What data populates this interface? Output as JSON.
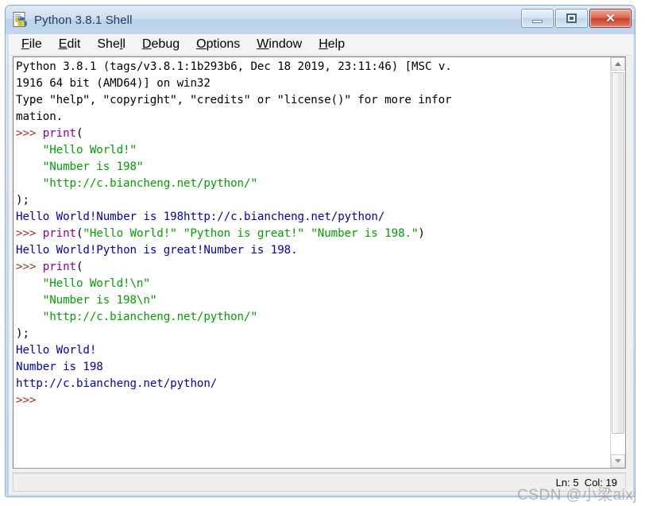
{
  "window": {
    "title": "Python 3.8.1 Shell",
    "icon": "python-idle-icon",
    "caption_buttons": [
      {
        "name": "minimize-button",
        "label": "–"
      },
      {
        "name": "maximize-button",
        "label": "□"
      },
      {
        "name": "close-button",
        "label": "✕"
      }
    ]
  },
  "menubar": {
    "items": [
      {
        "name": "menu-file",
        "pre": "",
        "mnemonic": "F",
        "post": "ile"
      },
      {
        "name": "menu-edit",
        "pre": "",
        "mnemonic": "E",
        "post": "dit"
      },
      {
        "name": "menu-shell",
        "pre": "She",
        "mnemonic": "l",
        "post": "l"
      },
      {
        "name": "menu-debug",
        "pre": "",
        "mnemonic": "D",
        "post": "ebug"
      },
      {
        "name": "menu-options",
        "pre": "",
        "mnemonic": "O",
        "post": "ptions"
      },
      {
        "name": "menu-window",
        "pre": "",
        "mnemonic": "W",
        "post": "indow"
      },
      {
        "name": "menu-help",
        "pre": "",
        "mnemonic": "H",
        "post": "elp"
      }
    ]
  },
  "console": {
    "lines": [
      {
        "id": "l01",
        "segments": [
          {
            "t": "Python 3.8.1 (tags/v3.8.1:1b293b6, Dec 18 2019, 23:11:46) [MSC v.",
            "c": "plain"
          }
        ]
      },
      {
        "id": "l02",
        "segments": [
          {
            "t": "1916 64 bit (AMD64)] on win32",
            "c": "plain"
          }
        ]
      },
      {
        "id": "l03",
        "segments": [
          {
            "t": "Type ʺhelpʺ, ʺcopyrightʺ, ʺcreditsʺ or ʺlicense()ʺ for more infor",
            "c": "plain"
          }
        ]
      },
      {
        "id": "l04",
        "segments": [
          {
            "t": "mation.",
            "c": "plain"
          }
        ]
      },
      {
        "id": "l05",
        "segments": [
          {
            "t": ">>> ",
            "c": "pmt"
          },
          {
            "t": "print",
            "c": "kw"
          },
          {
            "t": "(",
            "c": "plain"
          }
        ]
      },
      {
        "id": "l06",
        "segments": [
          {
            "t": "    ",
            "c": "plain"
          },
          {
            "t": "ʺHello World!ʺ",
            "c": "str"
          }
        ]
      },
      {
        "id": "l07",
        "segments": [
          {
            "t": "    ",
            "c": "plain"
          },
          {
            "t": "ʺNumber is 198ʺ",
            "c": "str"
          }
        ]
      },
      {
        "id": "l08",
        "segments": [
          {
            "t": "    ",
            "c": "plain"
          },
          {
            "t": "ʺhttp://c.biancheng.net/python/ʺ",
            "c": "str"
          }
        ]
      },
      {
        "id": "l09",
        "segments": [
          {
            "t": ");",
            "c": "plain"
          }
        ]
      },
      {
        "id": "l10",
        "segments": [
          {
            "t": "Hello World!Number is 198http://c.biancheng.net/python/",
            "c": "out"
          }
        ]
      },
      {
        "id": "l11",
        "segments": [
          {
            "t": ">>> ",
            "c": "pmt"
          },
          {
            "t": "print",
            "c": "kw"
          },
          {
            "t": "(",
            "c": "plain"
          },
          {
            "t": "ʺHello World!ʺ ʺPython is great!ʺ ʺNumber is 198.ʺ",
            "c": "str"
          },
          {
            "t": ")",
            "c": "plain"
          }
        ]
      },
      {
        "id": "l12",
        "segments": [
          {
            "t": "Hello World!Python is great!Number is 198.",
            "c": "out"
          }
        ]
      },
      {
        "id": "l13",
        "segments": [
          {
            "t": ">>> ",
            "c": "pmt"
          },
          {
            "t": "print",
            "c": "kw"
          },
          {
            "t": "(",
            "c": "plain"
          }
        ]
      },
      {
        "id": "l14",
        "segments": [
          {
            "t": "    ",
            "c": "plain"
          },
          {
            "t": "ʺHello World!\\nʺ",
            "c": "str"
          }
        ]
      },
      {
        "id": "l15",
        "segments": [
          {
            "t": "    ",
            "c": "plain"
          },
          {
            "t": "ʺNumber is 198\\nʺ",
            "c": "str"
          }
        ]
      },
      {
        "id": "l16",
        "segments": [
          {
            "t": "    ",
            "c": "plain"
          },
          {
            "t": "ʺhttp://c.biancheng.net/python/ʺ",
            "c": "str"
          }
        ]
      },
      {
        "id": "l17",
        "segments": [
          {
            "t": ");",
            "c": "plain"
          }
        ]
      },
      {
        "id": "l18",
        "segments": [
          {
            "t": "Hello World!",
            "c": "out"
          }
        ]
      },
      {
        "id": "l19",
        "segments": [
          {
            "t": "Number is 198",
            "c": "out"
          }
        ]
      },
      {
        "id": "l20",
        "segments": [
          {
            "t": "http://c.biancheng.net/python/",
            "c": "out"
          }
        ]
      },
      {
        "id": "l21",
        "segments": [
          {
            "t": ">>>",
            "c": "pmt"
          }
        ]
      }
    ],
    "colors": {
      "stdout": "#0000bb",
      "string": "#00a000",
      "builtin": "#900090",
      "prompt": "#a0301f",
      "plain": "#000000",
      "background": "#ffffff"
    }
  },
  "scrollbar": {
    "up_arrow": "scroll-up-arrow",
    "down_arrow": "scroll-down-arrow",
    "thumb": "scroll-thumb"
  },
  "statusbar": {
    "position_text": "Ln: 5  Col: 19"
  },
  "watermark": {
    "text": "CSDN @小梁aixj"
  },
  "theme": {
    "titlebar_accent": "#bcd2e8",
    "frame": "#b9d2ea",
    "title_text": "#1c3c63",
    "close_button": "#c9402c"
  }
}
